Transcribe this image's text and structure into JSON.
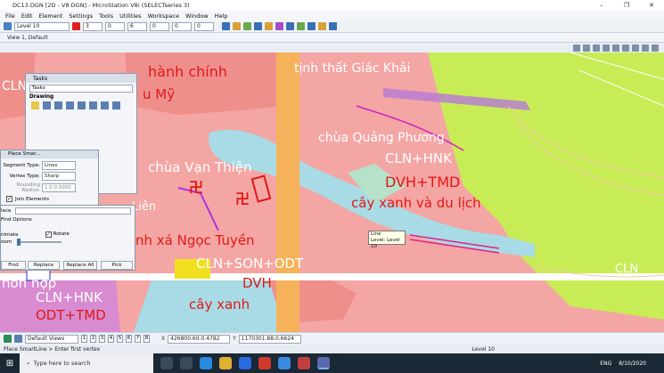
{
  "window": {
    "title": "DC13.DGN [2D - V8 DGN] - MicroStation V8i (SELECTseries 3)",
    "minimize": "–",
    "maximize": "❐",
    "close": "✕"
  },
  "menu": [
    "File",
    "Edit",
    "Element",
    "Settings",
    "Tools",
    "Utilities",
    "Workspace",
    "Window",
    "Help"
  ],
  "toolbar": {
    "level": "Level 10",
    "color_value": "3",
    "weight_value": "0",
    "style_value": "6",
    "class_value": "0",
    "transparency_value": "0",
    "priority_value": "0"
  },
  "view_tab": "View 1, Default",
  "map_labels": [
    "hành chính",
    "u Mỹ",
    "tịnh thất Giác Khải",
    "chùa Quảng Phương",
    "CLN+HNK",
    "chùa Vạn Thiện",
    "DVH+TMD",
    "cây xanh và du lịch",
    "Liên",
    "nh xá Ngọc Tuyền",
    "CLN+SON+ODT",
    "DVH",
    "cây xanh",
    "hỗn hợp",
    "CLN+HNK",
    "ODT+TMD",
    "CLN",
    "CLN"
  ],
  "tasks_panel": {
    "title": "Tasks",
    "dropdown": "Tasks",
    "section": "Drawing"
  },
  "place_panel": {
    "title": "Place Smar...",
    "segment_label": "Segment Type:",
    "segment_value": "Lines",
    "vertex_label": "Vertex Type:",
    "vertex_value": "Sharp",
    "rounding_label": "Rounding Radius:",
    "rounding_value": "1.0.0.0000",
    "join_label": "Join Elements"
  },
  "find_panel": {
    "replace_label": "lace",
    "find_options": "Find Options",
    "animate": "nimate",
    "rotate": "Rotate",
    "zoom": "oom",
    "find_btn": "Find",
    "replace_btn": "Replace",
    "replace_all_btn": "Replace All",
    "pick_btn": "Pick"
  },
  "tooltip": {
    "line1": "Line",
    "line2": "Level: Level 10"
  },
  "bottom": {
    "views_dropdown": "Default Views",
    "view_numbers": [
      "1",
      "2",
      "3",
      "4",
      "5",
      "6",
      "7",
      "8"
    ],
    "x_coord": "426800.60.0.4782",
    "y_coord": "1170301.88.0.6624",
    "level": "Level 10"
  },
  "status": "Place SmartLine > Enter first vertex",
  "taskbar": {
    "search_placeholder": "Type here to search",
    "lang": "ENG",
    "time": "",
    "date": "8/10/2020"
  },
  "colors": {
    "pink": "#f4a6a4",
    "salmon": "#ef8f8c",
    "lime": "#c8ec56",
    "blue": "#a8dbe5",
    "red_text": "#e01818",
    "white_text": "#ffffff",
    "orange_road": "#f6b25a"
  }
}
